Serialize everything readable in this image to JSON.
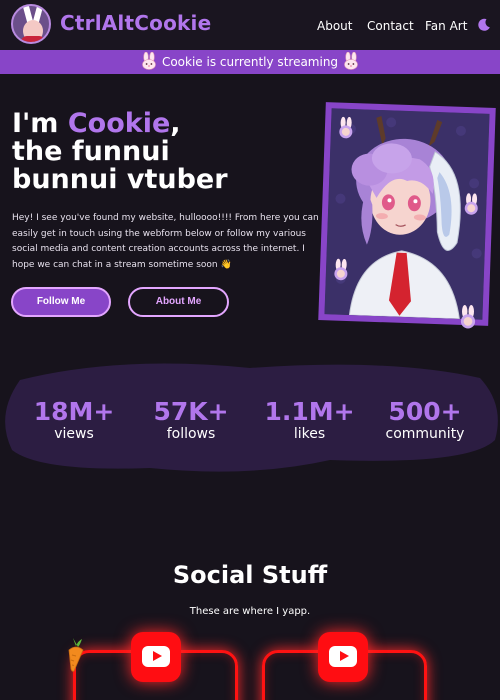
{
  "header": {
    "site_title": "CtrlAltCookie",
    "nav": [
      {
        "label": "About"
      },
      {
        "label": "Contact"
      },
      {
        "label": "Fan Art"
      }
    ],
    "theme_toggle_icon": "moon-icon"
  },
  "banner": {
    "text": "Cookie is currently streaming",
    "icon": "bunny-icon"
  },
  "hero": {
    "title_prefix": "I'm ",
    "title_name": "Cookie",
    "title_suffix": ",",
    "title_line2": "the funnui",
    "title_line3": "bunnui vtuber",
    "description": "Hey! I see you've found my website, hulloooo!!!! From here you can easily get in touch using the webform below or follow my various social media and content creation accounts across the internet. I hope we can chat in a stream sometime soon 👋",
    "follow_button": "Follow Me",
    "about_button": "About Me"
  },
  "stats": [
    {
      "value": "18M+",
      "label": "views"
    },
    {
      "value": "57K+",
      "label": "follows"
    },
    {
      "value": "1.1M+",
      "label": "likes"
    },
    {
      "value": "500+",
      "label": "community"
    }
  ],
  "social": {
    "title": "Social Stuff",
    "subtitle": "These are where I yapp.",
    "cards": [
      {
        "icon": "youtube-icon"
      },
      {
        "icon": "youtube-icon"
      }
    ],
    "decoration_icon": "carrot-icon"
  },
  "colors": {
    "background": "#17131c",
    "accent_purple": "#b176ec",
    "banner_purple": "#8845c8",
    "button_border": "#e3a6ff",
    "youtube_red": "#ff0d12"
  }
}
